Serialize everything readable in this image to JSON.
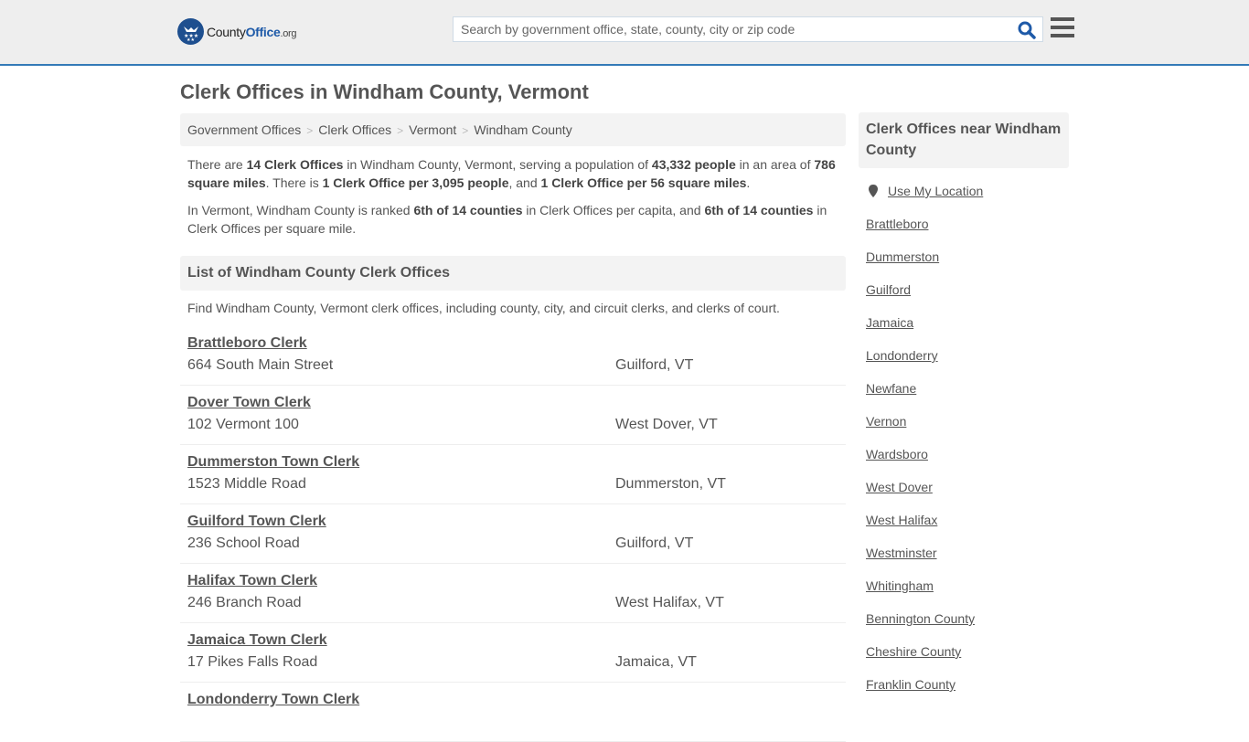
{
  "header": {
    "logo": {
      "name_plain": "County",
      "name_bold": "Office",
      "tld": ".org"
    },
    "search": {
      "placeholder": "Search by government office, state, county, city or zip code",
      "value": ""
    },
    "colors": {
      "accent": "#337ab7",
      "logo_blue": "#1e4f8f",
      "header_bg": "#eeeeee"
    }
  },
  "page": {
    "title": "Clerk Offices in Windham County, Vermont"
  },
  "breadcrumb": [
    "Government Offices",
    "Clerk Offices",
    "Vermont",
    "Windham County"
  ],
  "intro": {
    "p1": {
      "t1": "There are ",
      "b1": "14 Clerk Offices",
      "t2": " in Windham County, Vermont, serving a population of ",
      "b2": "43,332 people",
      "t3": " in an area of ",
      "b3": "786 square miles",
      "t4": ". There is ",
      "b4": "1 Clerk Office per 3,095 people",
      "t5": ", and ",
      "b5": "1 Clerk Office per 56 square miles",
      "t6": "."
    },
    "p2": {
      "t1": "In Vermont, Windham County is ranked ",
      "b1": "6th of 14 counties",
      "t2": " in Clerk Offices per capita, and ",
      "b2": "6th of 14 counties",
      "t3": " in Clerk Offices per square mile."
    }
  },
  "list": {
    "title": "List of Windham County Clerk Offices",
    "description": "Find Windham County, Vermont clerk offices, including county, city, and circuit clerks, and clerks of court.",
    "offices": [
      {
        "name": "Brattleboro Clerk",
        "address": "664 South Main Street",
        "city": "Guilford, VT"
      },
      {
        "name": "Dover Town Clerk",
        "address": "102 Vermont 100",
        "city": "West Dover, VT"
      },
      {
        "name": "Dummerston Town Clerk",
        "address": "1523 Middle Road",
        "city": "Dummerston, VT"
      },
      {
        "name": "Guilford Town Clerk",
        "address": "236 School Road",
        "city": "Guilford, VT"
      },
      {
        "name": "Halifax Town Clerk",
        "address": "246 Branch Road",
        "city": "West Halifax, VT"
      },
      {
        "name": "Jamaica Town Clerk",
        "address": "17 Pikes Falls Road",
        "city": "Jamaica, VT"
      },
      {
        "name": "Londonderry Town Clerk",
        "address": "",
        "city": ""
      }
    ]
  },
  "sidebar": {
    "title": "Clerk Offices near Windham County",
    "use_location": "Use My Location",
    "links": [
      "Brattleboro",
      "Dummerston",
      "Guilford",
      "Jamaica",
      "Londonderry",
      "Newfane",
      "Vernon",
      "Wardsboro",
      "West Dover",
      "West Halifax",
      "Westminster",
      "Whitingham",
      "Bennington County",
      "Cheshire County",
      "Franklin County"
    ]
  }
}
